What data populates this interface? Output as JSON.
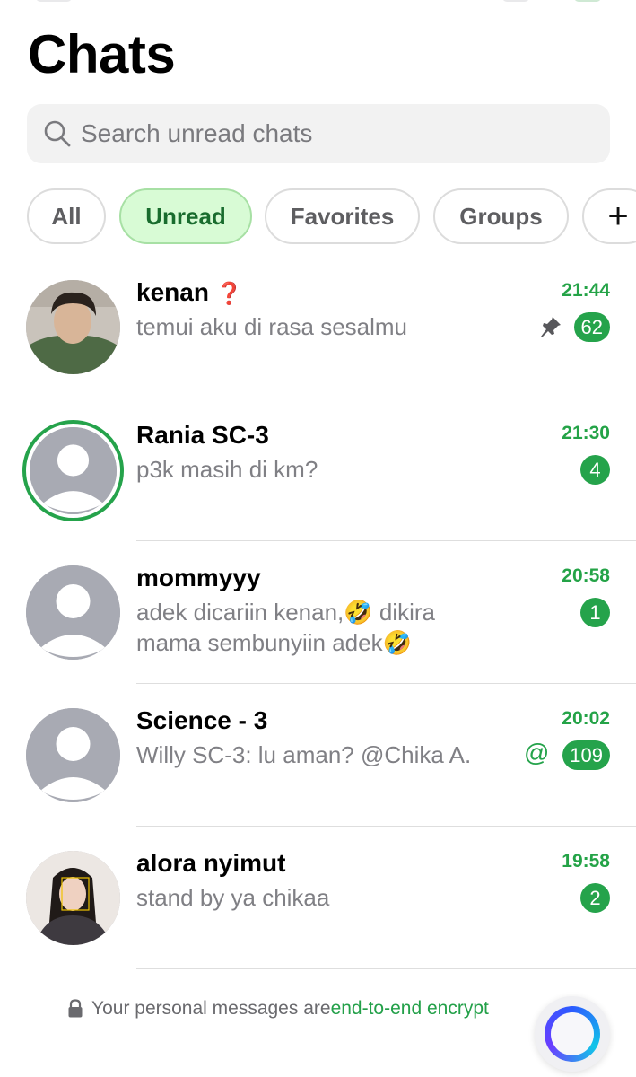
{
  "header": {
    "title": "Chats"
  },
  "search": {
    "placeholder": "Search unread chats"
  },
  "filters": [
    {
      "label": "All",
      "active": false
    },
    {
      "label": "Unread",
      "active": true
    },
    {
      "label": "Favorites",
      "active": false
    },
    {
      "label": "Groups",
      "active": false
    },
    {
      "label": "+",
      "active": false
    }
  ],
  "chats": [
    {
      "name": "kenan",
      "name_suffix": "❓",
      "preview": "temui aku di rasa sesalmu",
      "time": "21:44",
      "badge": "62",
      "pinned": true,
      "avatar": "photo"
    },
    {
      "name": "Rania SC-3",
      "name_suffix": "",
      "preview": "p3k masih di km?",
      "time": "21:30",
      "badge": "4",
      "pinned": false,
      "avatar": "placeholder-with-status"
    },
    {
      "name": "mommyyy",
      "name_suffix": "",
      "preview": "adek dicariin kenan,🤣 dikira mama sembunyiin adek🤣",
      "time": "20:58",
      "badge": "1",
      "pinned": false,
      "avatar": "placeholder"
    },
    {
      "name": "Science - 3",
      "name_suffix": "",
      "preview": "Willy SC-3: lu aman? @Chika A.",
      "time": "20:02",
      "badge": "109",
      "pinned": false,
      "mention": "@",
      "avatar": "placeholder"
    },
    {
      "name": "alora nyimut",
      "name_suffix": "",
      "preview": "stand by ya chikaa",
      "time": "19:58",
      "badge": "2",
      "pinned": false,
      "avatar": "photo"
    }
  ],
  "footer": {
    "text": "Your personal messages are ",
    "link": "end-to-end encrypt"
  },
  "colors": {
    "accent": "#25a34b",
    "chip_active_bg": "#d8fbd5",
    "chip_active_text": "#196c2e"
  },
  "icons": {
    "search": "search-icon",
    "pin": "pin-icon",
    "lock": "lock-icon",
    "ai": "meta-ai-icon"
  }
}
